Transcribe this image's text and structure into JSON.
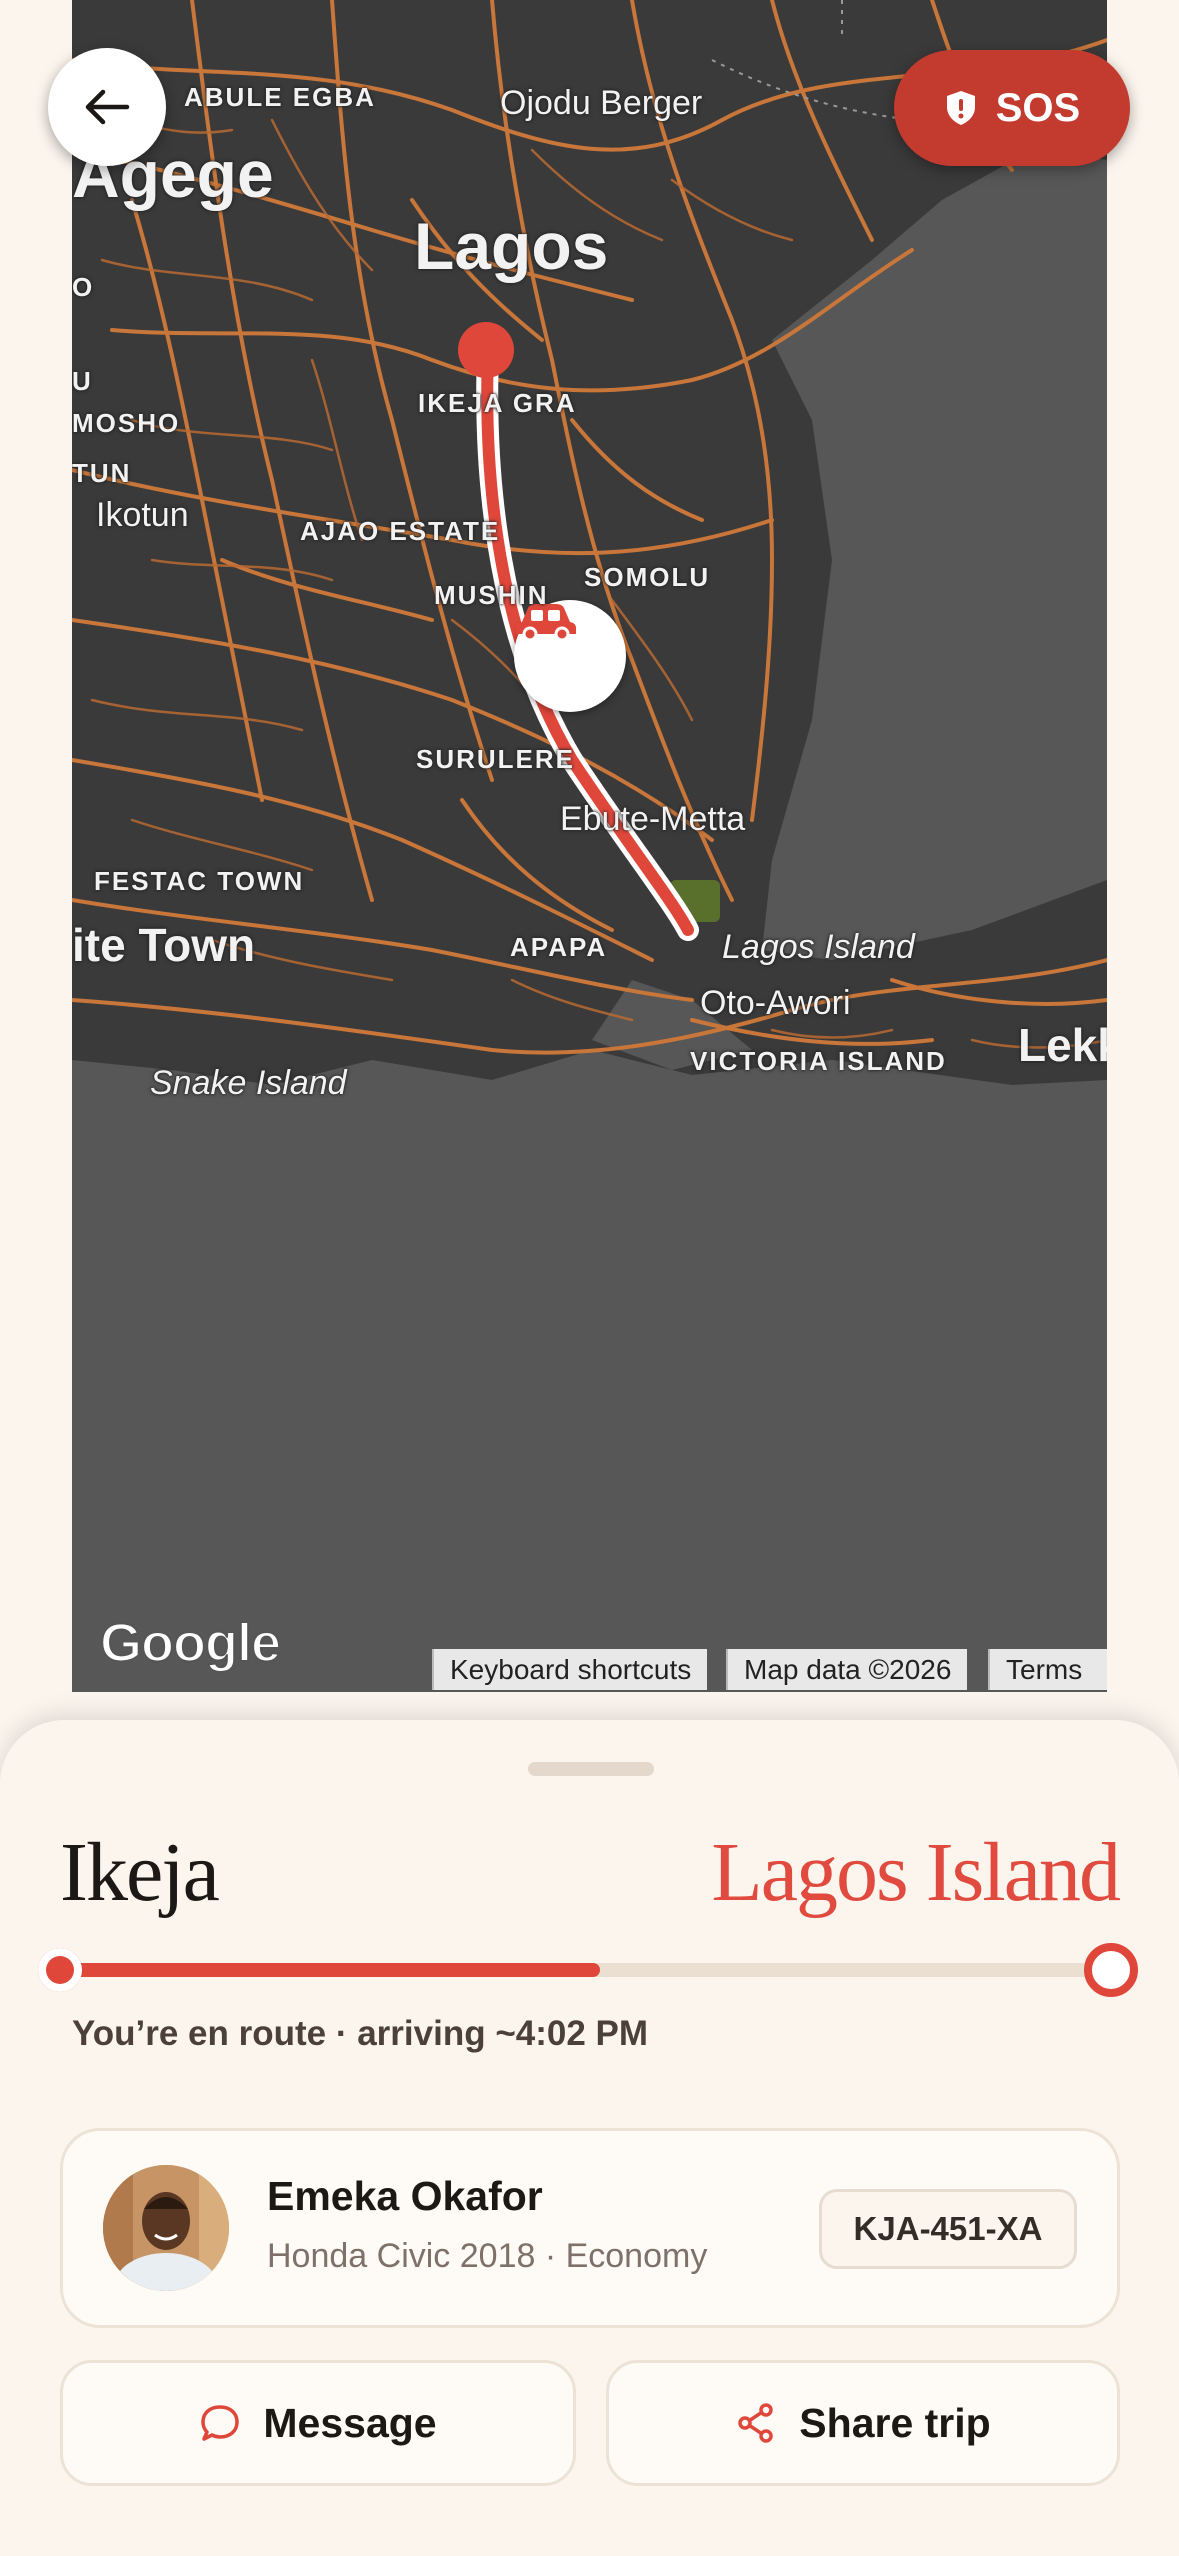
{
  "map": {
    "labels": {
      "abule_egba": "ABULE EGBA",
      "ojodu_berger": "Ojodu Berger",
      "agege": "Agege",
      "lagos": "Lagos",
      "ikeja_gra": "IKEJA GRA",
      "mosho": "MOSHO",
      "tun": "TUN",
      "ikotun": "Ikotun",
      "ajao_estate": "AJAO ESTATE",
      "mushin": "MUSHIN",
      "somolu": "SOMOLU",
      "surulere": "SURULERE",
      "ebute_metta": "Ebute-Metta",
      "festac_town": "FESTAC TOWN",
      "satellite_town": "ite Town",
      "apapa": "APAPA",
      "lagos_island": "Lagos Island",
      "oto_awori": "Oto-Awori",
      "victoria_island": "VICTORIA ISLAND",
      "lekki": "Lekk",
      "snake_island": "Snake Island",
      "left_o": "O",
      "left_u": "U"
    },
    "google_logo": "Google",
    "attribution": {
      "keyboard": "Keyboard shortcuts",
      "map_data": "Map data ©2026",
      "terms": "Terms"
    },
    "car_icon": "car-icon",
    "pin_icon": "map-pin-icon"
  },
  "back_button": {
    "icon": "arrow-left-icon"
  },
  "sos_button": {
    "label": "SOS",
    "icon": "shield-alert-icon",
    "color": "#c33a2e"
  },
  "trip": {
    "from": "Ikeja",
    "to": "Lagos Island",
    "progress": 0.51,
    "status": "You’re en route · arriving ~4:02 PM"
  },
  "driver": {
    "name": "Emeka Okafor",
    "vehicle": "Honda Civic 2018 · Economy",
    "plate": "KJA-451-XA"
  },
  "actions": {
    "message_label": "Message",
    "message_icon": "chat-bubble-icon",
    "share_label": "Share trip",
    "share_icon": "share-icon"
  },
  "colors": {
    "accent": "#e0473b",
    "background": "#fcf5ee",
    "road": "#e0873f"
  }
}
